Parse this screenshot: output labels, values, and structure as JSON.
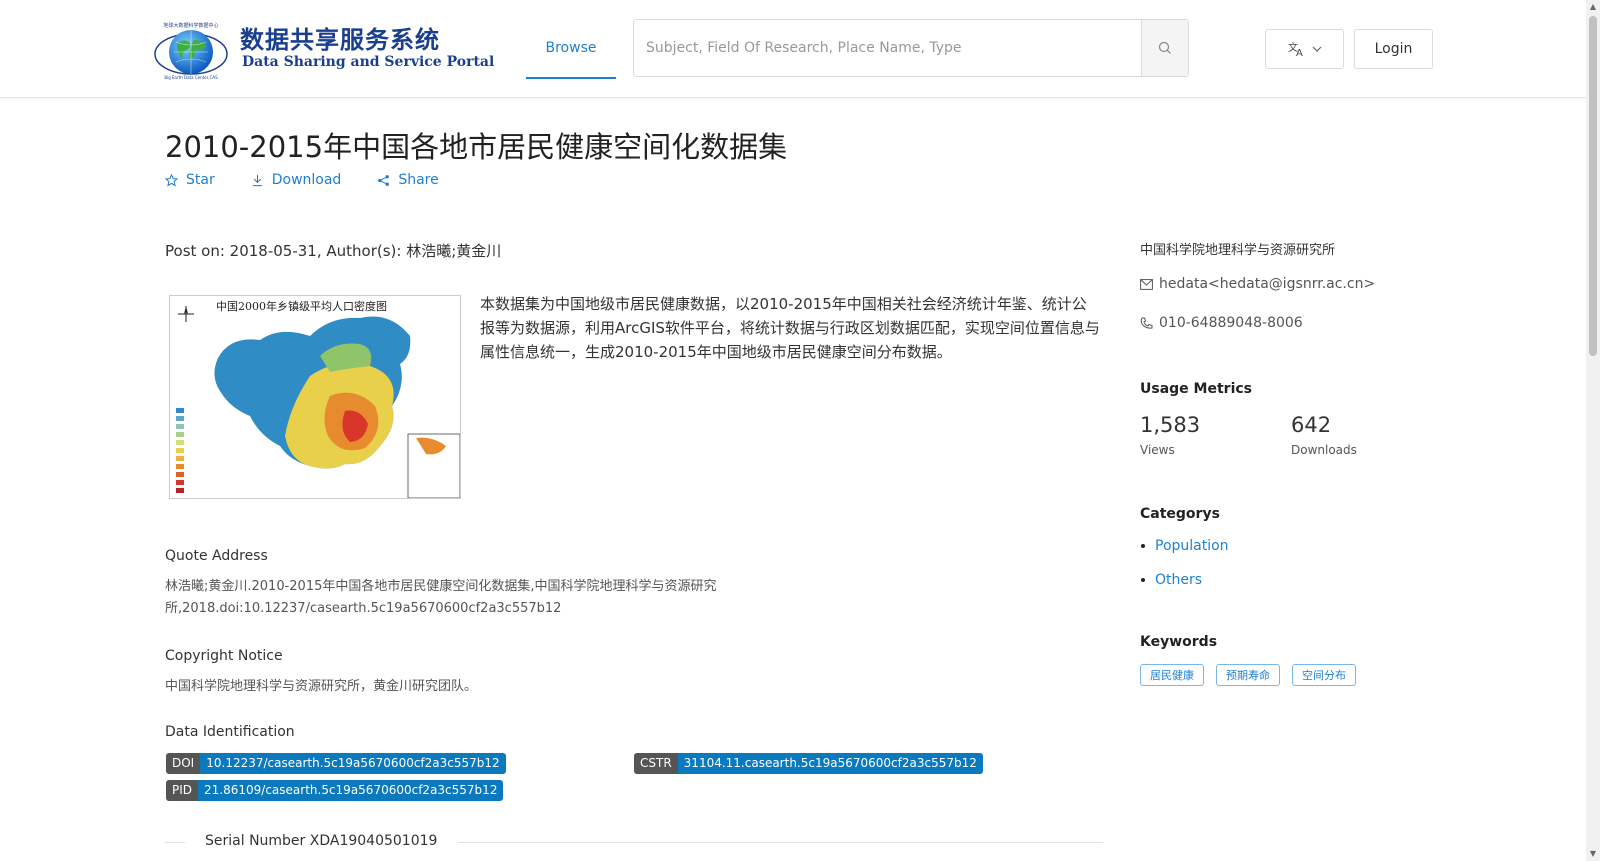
{
  "header": {
    "logo_cn": "数据共享服务系统",
    "logo_en": "Data Sharing and Service Portal",
    "logo_arc": "地球大数据科学数据中心",
    "logo_sub": "Big Earth Data Center,CAS",
    "nav_browse": "Browse",
    "search_placeholder": "Subject, Field Of Research, Place Name, Type",
    "language_icon": "translate-icon",
    "login_label": "Login"
  },
  "dataset": {
    "title": "2010-2015年中国各地市居民健康空间化数据集",
    "actions": {
      "star": "Star",
      "download": "Download",
      "share": "Share"
    },
    "meta": "Post on: 2018-05-31, Author(s): 林浩曦;黄金川",
    "thumbnail_title": "中国2000年乡镇级平均人口密度图",
    "description": "本数据集为中国地级市居民健康数据，以2010-2015年中国相关社会经济统计年鉴、统计公报等为数据源，利用ArcGIS软件平台，将统计数据与行政区划数据匹配，实现空间位置信息与属性信息统一，生成2010-2015年中国地级市居民健康空间分布数据。",
    "quote_label": "Quote Address",
    "quote_text": "林浩曦;黄金川.2010-2015年中国各地市居民健康空间化数据集,中国科学院地理科学与资源研究所,2018.doi:10.12237/casearth.5c19a5670600cf2a3c557b12",
    "copyright_label": "Copyright Notice",
    "copyright_text": "中国科学院地理科学与资源研究所，黄金川研究团队。",
    "identification_label": "Data Identification",
    "doi_key": "DOI",
    "doi_value": "10.12237/casearth.5c19a5670600cf2a3c557b12",
    "cstr_key": "CSTR",
    "cstr_value": "31104.11.casearth.5c19a5670600cf2a3c557b12",
    "pid_key": "PID",
    "pid_value": "21.86109/casearth.5c19a5670600cf2a3c557b12",
    "serial": "Serial Number XDA19040501019"
  },
  "sidebar": {
    "org": "中国科学院地理科学与资源研究所",
    "email": "hedata<hedata@igsnrr.ac.cn>",
    "phone": "010-64889048-8006",
    "usage_head": "Usage Metrics",
    "views_value": "1,583",
    "views_label": "Views",
    "downloads_value": "642",
    "downloads_label": "Downloads",
    "categories_head": "Categorys",
    "categories": [
      "Population",
      "Others"
    ],
    "keywords_head": "Keywords",
    "keywords": [
      "居民健康",
      "预期寿命",
      "空间分布"
    ]
  },
  "colors": {
    "accent": "#1f7fd1",
    "badge_value": "#0a79bd",
    "badge_key": "#555555",
    "logo_blue": "#1b3f8f"
  }
}
